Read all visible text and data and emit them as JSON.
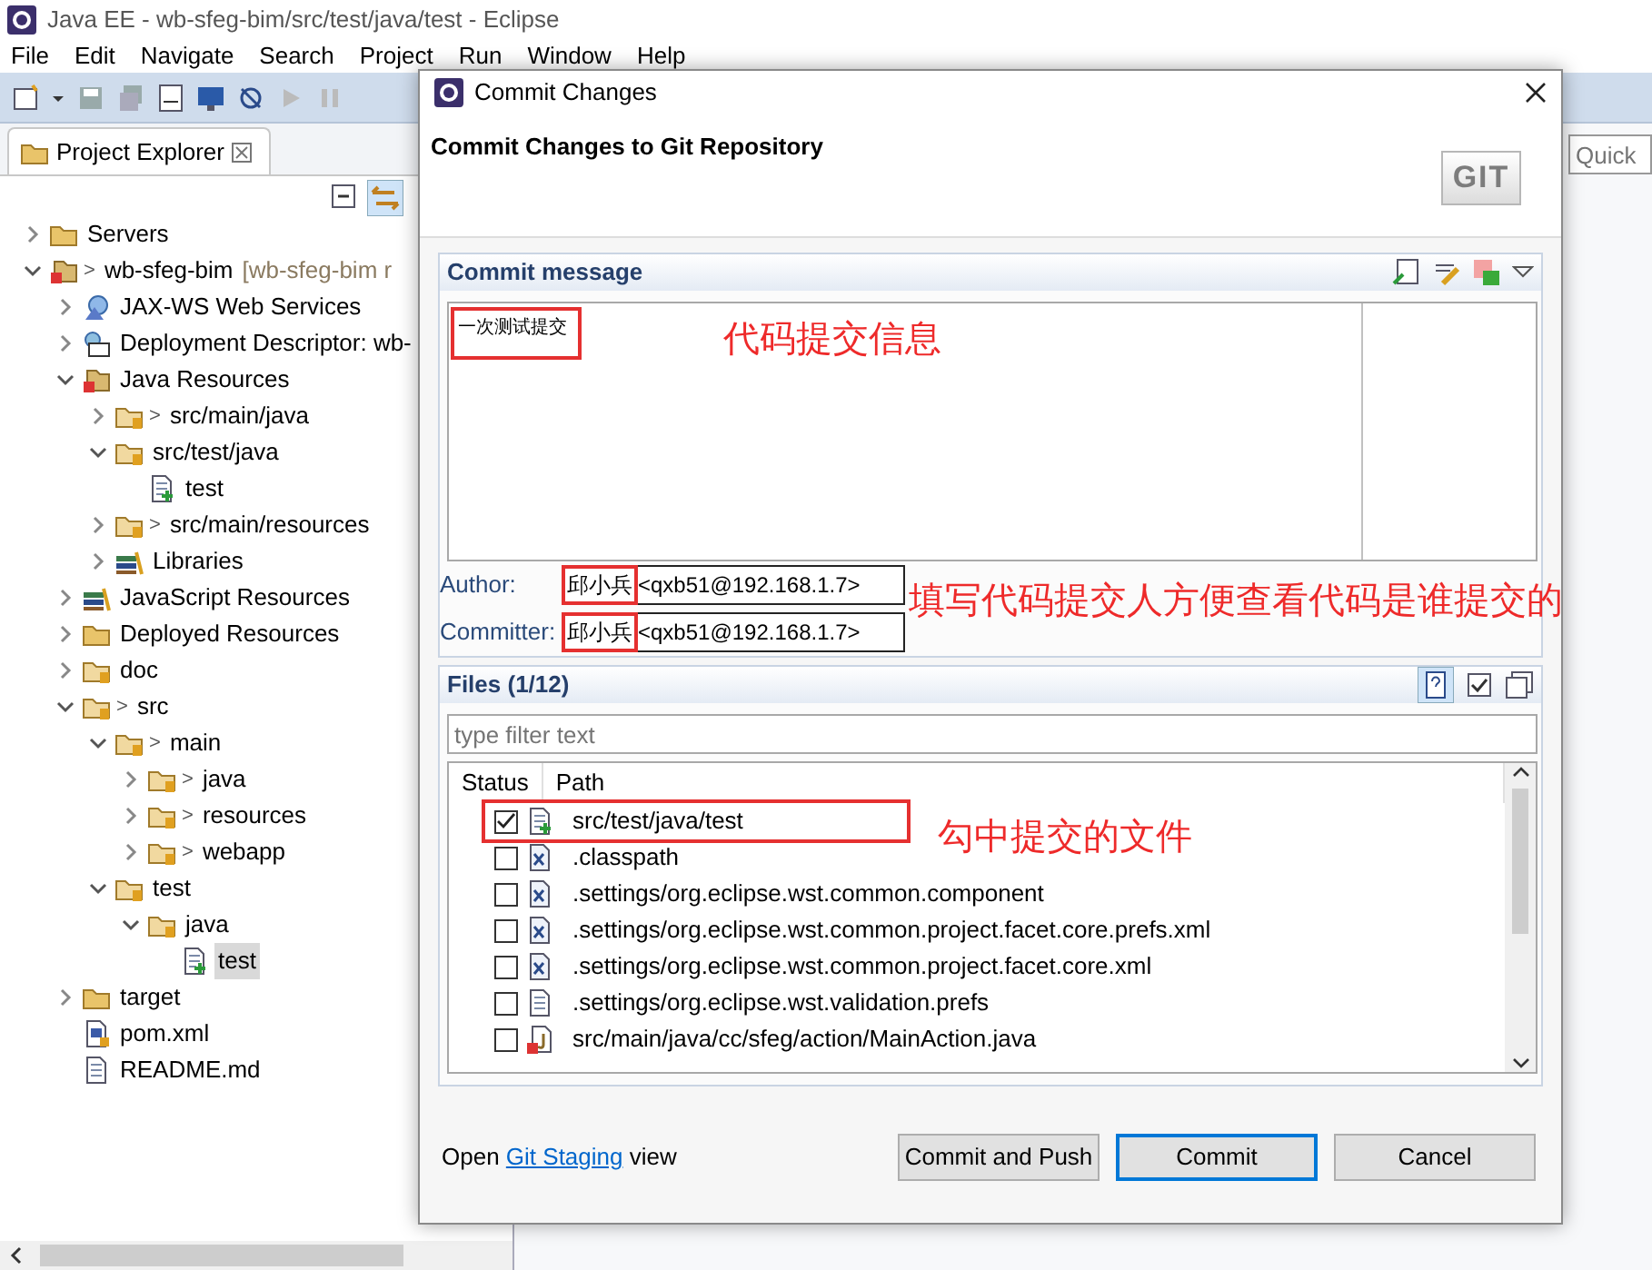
{
  "window": {
    "title": "Java EE - wb-sfeg-bim/src/test/java/test - Eclipse"
  },
  "menu": [
    "File",
    "Edit",
    "Navigate",
    "Search",
    "Project",
    "Run",
    "Window",
    "Help"
  ],
  "quick_access": {
    "placeholder": "Quick"
  },
  "explorer": {
    "title": "Project Explorer",
    "tree": [
      {
        "label": "Servers",
        "kind": "folder",
        "expanded": false,
        "selected": false
      },
      {
        "label": "wb-sfeg-bim",
        "prefix": ">",
        "suffix": "[wb-sfeg-bim r",
        "kind": "project",
        "expanded": true,
        "selected": false,
        "children": [
          {
            "label": "JAX-WS Web Services",
            "kind": "services",
            "expanded": false,
            "selected": false
          },
          {
            "label": "Deployment Descriptor: wb-",
            "kind": "descriptor",
            "expanded": false,
            "selected": false
          },
          {
            "label": "Java Resources",
            "kind": "project",
            "expanded": true,
            "selected": false,
            "children": [
              {
                "label": "src/main/java",
                "prefix": ">",
                "kind": "package",
                "expanded": false,
                "selected": false
              },
              {
                "label": "src/test/java",
                "kind": "package",
                "expanded": true,
                "selected": false,
                "children": [
                  {
                    "label": "test",
                    "kind": "newfile",
                    "selected": false
                  }
                ]
              },
              {
                "label": "src/main/resources",
                "prefix": ">",
                "kind": "package",
                "expanded": false,
                "selected": false
              },
              {
                "label": "Libraries",
                "kind": "library",
                "expanded": false,
                "selected": false
              }
            ]
          },
          {
            "label": "JavaScript Resources",
            "kind": "library",
            "expanded": false,
            "selected": false
          },
          {
            "label": "Deployed Resources",
            "kind": "folder",
            "expanded": false,
            "selected": false
          },
          {
            "label": "doc",
            "kind": "package",
            "expanded": false,
            "selected": false
          },
          {
            "label": "src",
            "prefix": ">",
            "kind": "package",
            "expanded": true,
            "selected": false,
            "children": [
              {
                "label": "main",
                "prefix": ">",
                "kind": "package",
                "expanded": true,
                "selected": false,
                "children": [
                  {
                    "label": "java",
                    "prefix": ">",
                    "kind": "package",
                    "expanded": false,
                    "selected": false
                  },
                  {
                    "label": "resources",
                    "prefix": ">",
                    "kind": "package",
                    "expanded": false,
                    "selected": false
                  },
                  {
                    "label": "webapp",
                    "prefix": ">",
                    "kind": "package",
                    "expanded": false,
                    "selected": false
                  }
                ]
              },
              {
                "label": "test",
                "kind": "package",
                "expanded": true,
                "selected": false,
                "children": [
                  {
                    "label": "java",
                    "kind": "package",
                    "expanded": true,
                    "selected": false,
                    "children": [
                      {
                        "label": "test",
                        "kind": "newfile",
                        "selected": true
                      }
                    ]
                  }
                ]
              }
            ]
          },
          {
            "label": "target",
            "kind": "folder",
            "expanded": false,
            "selected": false
          },
          {
            "label": "pom.xml",
            "kind": "xmlfile",
            "selected": false
          },
          {
            "label": "README.md",
            "kind": "textfile",
            "selected": false
          }
        ]
      }
    ]
  },
  "dialog": {
    "title": "Commit Changes",
    "heading": "Commit Changes to Git Repository",
    "logo": "GIT",
    "commit_message": {
      "label": "Commit message",
      "value": "一次测试提交",
      "boxed": true
    },
    "author": {
      "label": "Author:",
      "name": "邱小兵",
      "email": "<qxb51@192.168.1.7>",
      "boxed": true
    },
    "committer": {
      "label": "Committer:",
      "name": "邱小兵",
      "email": "<qxb51@192.168.1.7>",
      "boxed": true
    },
    "files": {
      "label": "Files (1/12)",
      "filter_placeholder": "type filter text",
      "columns": [
        "Status",
        "Path"
      ],
      "rows": [
        {
          "checked": true,
          "kind": "newfile",
          "path": "src/test/java/test",
          "boxed": true
        },
        {
          "checked": false,
          "kind": "xfile",
          "path": ".classpath",
          "boxed": false
        },
        {
          "checked": false,
          "kind": "xfile",
          "path": ".settings/org.eclipse.wst.common.component",
          "boxed": false
        },
        {
          "checked": false,
          "kind": "xfile",
          "path": ".settings/org.eclipse.wst.common.project.facet.core.prefs.xml",
          "boxed": false
        },
        {
          "checked": false,
          "kind": "xfile",
          "path": ".settings/org.eclipse.wst.common.project.facet.core.xml",
          "boxed": false
        },
        {
          "checked": false,
          "kind": "textfile",
          "path": ".settings/org.eclipse.wst.validation.prefs",
          "boxed": false
        },
        {
          "checked": false,
          "kind": "javafile",
          "path": "src/main/java/cc/sfeg/action/MainAction.java",
          "boxed": false
        }
      ]
    },
    "hint": {
      "before": "Open",
      "link": "Git Staging",
      "after": "view"
    },
    "buttons": [
      {
        "label": "Commit and Push",
        "default": false
      },
      {
        "label": "Commit",
        "default": true
      },
      {
        "label": "Cancel",
        "default": false
      }
    ]
  },
  "annotations": [
    {
      "text": "代码提交信息"
    },
    {
      "text": "填写代码提交人方便查看代码是谁提交的"
    },
    {
      "text": "勾中提交的文件"
    }
  ]
}
